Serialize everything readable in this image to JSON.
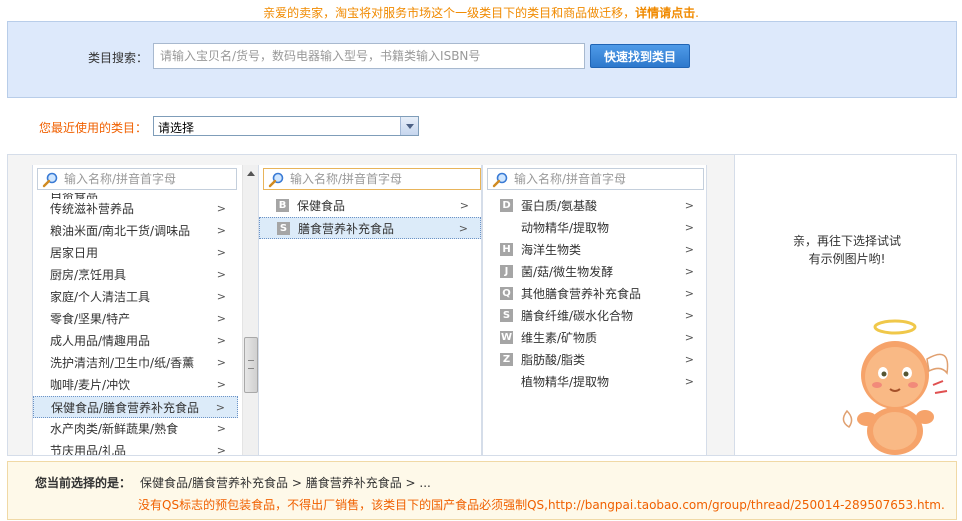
{
  "notice": {
    "text": "亲爱的卖家，淘宝将对服务市场这个一级类目下的类目和商品做迁移，",
    "link": "详情请点击",
    "suffix": "."
  },
  "search": {
    "label": "类目搜索：",
    "placeholder": "请输入宝贝名/货号，数码电器输入型号，书籍类输入ISBN号",
    "button_label": "快速找到类目"
  },
  "recent": {
    "label": "您最近使用的类目：",
    "selected": "请选择"
  },
  "filter_placeholder": "输入名称/拼音首字母",
  "column1": {
    "clipped_item": "自资食品",
    "items": [
      {
        "label": "传统滋补营养品"
      },
      {
        "label": "粮油米面/南北干货/调味品"
      },
      {
        "label": "居家日用"
      },
      {
        "label": "厨房/烹饪用具"
      },
      {
        "label": "家庭/个人清洁工具"
      },
      {
        "label": "零食/坚果/特产"
      },
      {
        "label": "成人用品/情趣用品"
      },
      {
        "label": "洗护清洁剂/卫生巾/纸/香薰"
      },
      {
        "label": "咖啡/麦片/冲饮"
      },
      {
        "label": "保健食品/膳食营养补充食品",
        "selected": true
      },
      {
        "label": "水产肉类/新鲜蔬果/熟食"
      },
      {
        "label": "节庆用品/礼品"
      }
    ]
  },
  "column2": {
    "items": [
      {
        "letter": "B",
        "label": "保健食品"
      },
      {
        "letter": "S",
        "label": "膳食营养补充食品",
        "selected": true
      }
    ]
  },
  "column3": {
    "items": [
      {
        "letter": "D",
        "label": "蛋白质/氨基酸"
      },
      {
        "letter": "",
        "label": "动物精华/提取物"
      },
      {
        "letter": "H",
        "label": "海洋生物类"
      },
      {
        "letter": "J",
        "label": "菌/菇/微生物发酵"
      },
      {
        "letter": "Q",
        "label": "其他膳食营养补充食品"
      },
      {
        "letter": "S",
        "label": "膳食纤维/碳水化合物"
      },
      {
        "letter": "W",
        "label": "维生素/矿物质"
      },
      {
        "letter": "Z",
        "label": "脂肪酸/脂类"
      },
      {
        "letter": "",
        "label": "植物精华/提取物"
      }
    ]
  },
  "preview": {
    "line1": "亲，再往下选择试试",
    "line2": "有示例图片哟!",
    "mascot_icon": "angel-mascot-icon"
  },
  "status": {
    "label": "您当前选择的是：",
    "path": "保健食品/膳食营养补充食品 > 膳食营养补充食品 > ...",
    "warning": "没有QS标志的预包装食品，不得出厂销售，该类目下的国产食品必须强制QS,http://bangpai.taobao.com/group/thread/250014-289507653.htm."
  },
  "colors": {
    "accent_orange": "#f06000",
    "notice_orange": "#f08a00",
    "button_blue": "#2d78cc",
    "panel_blue": "#dde9fb",
    "selected_bg": "#dcebf9",
    "status_bg": "#fef9e9"
  }
}
